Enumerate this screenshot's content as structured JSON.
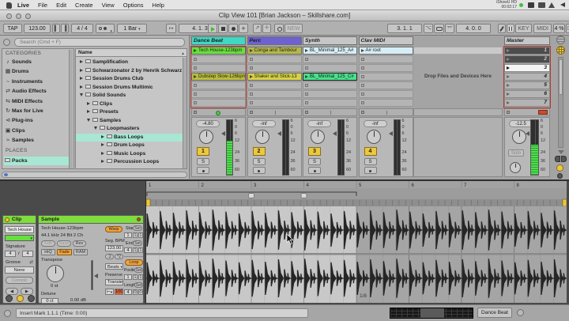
{
  "colors": {
    "accent_orange": "#f2a43c",
    "button_yellow": "#ecc83e",
    "play_green": "#4fd32e",
    "meter_green": "#4ce04c",
    "record_red": "#c2402f",
    "track_teal": "#3fd8c2",
    "track_purple": "#6e62d1",
    "selection_teal": "#a7e7d3",
    "red_border": "#b23a2e",
    "clipview_bg": "#4a4a4a"
  },
  "menu_bar": {
    "items": [
      "Live",
      "File",
      "Edit",
      "Create",
      "View",
      "Options",
      "Help"
    ],
    "status_line1": "iShowU HD",
    "status_line2": "00:02:17"
  },
  "title_bar": {
    "title": "Clip View 101  [Brian Jackson – Skillshare.com]"
  },
  "transport": {
    "tap": "TAP",
    "tempo": "123.00",
    "signature": "4 / 4",
    "quantization": "1 Bar",
    "arrangement_position": "4. 1. 3",
    "loop_start": "3. 1. 1",
    "loop_length": "4. 0. 0",
    "new_label": "NEW",
    "key_label": "KEY",
    "midi_label": "MIDI",
    "cpu": "4 %",
    "disk": "D"
  },
  "browser": {
    "search_placeholder": "Search (Cmd + F)",
    "categories_header": "CATEGORIES",
    "categories": [
      {
        "label": "Sounds",
        "icon": "note-icon"
      },
      {
        "label": "Drums",
        "icon": "drum-grid-icon"
      },
      {
        "label": "Instruments",
        "icon": "wave-icon"
      },
      {
        "label": "Audio Effects",
        "icon": "audio-fx-icon"
      },
      {
        "label": "MIDI Effects",
        "icon": "midi-fx-icon"
      },
      {
        "label": "Max for Live",
        "icon": "max-icon"
      },
      {
        "label": "Plug-ins",
        "icon": "plug-icon"
      },
      {
        "label": "Clips",
        "icon": "clip-icon"
      },
      {
        "label": "Samples",
        "icon": "sample-icon"
      }
    ],
    "places_header": "PLACES",
    "places": [
      {
        "label": "Packs",
        "selected": true
      }
    ],
    "name_header": "Name",
    "tree": [
      {
        "label": "Samplification",
        "depth": 0,
        "disclosure": "right"
      },
      {
        "label": "Schwarzonator 2 by Henrik Schwarz",
        "depth": 0,
        "disclosure": "right"
      },
      {
        "label": "Session Drums Club",
        "depth": 0,
        "disclosure": "right"
      },
      {
        "label": "Session Drums Multimic",
        "depth": 0,
        "disclosure": "right"
      },
      {
        "label": "Solid Sounds",
        "depth": 0,
        "disclosure": "down"
      },
      {
        "label": "Clips",
        "depth": 1,
        "disclosure": "right"
      },
      {
        "label": "Presets",
        "depth": 1,
        "disclosure": "right"
      },
      {
        "label": "Samples",
        "depth": 1,
        "disclosure": "down"
      },
      {
        "label": "Loopmasters",
        "depth": 2,
        "disclosure": "down"
      },
      {
        "label": "Bass Loops",
        "depth": 3,
        "disclosure": "right",
        "selected": true
      },
      {
        "label": "Drum Loops",
        "depth": 3,
        "disclosure": "right"
      },
      {
        "label": "Music Loops",
        "depth": 3,
        "disclosure": "right"
      },
      {
        "label": "Percussion Loops",
        "depth": 3,
        "disclosure": "right"
      }
    ]
  },
  "session": {
    "drop_hint": "Drop Files and Devices Here",
    "rows": 7,
    "tracks": [
      {
        "name": "Dance Beat",
        "color": "#3fd8c2",
        "armed": true,
        "clips": [
          {
            "row": 0,
            "name": "Tech House-123bpm",
            "color": "#66e03c",
            "playing": true
          },
          {
            "row": 3,
            "name": "Dubstep Slow-126bpm",
            "color": "#b9bd3c"
          }
        ]
      },
      {
        "name": "Perc",
        "color": "#6e62d1",
        "clips": [
          {
            "row": 0,
            "name": "Conga and Tambour",
            "color": "#b4b84a"
          },
          {
            "row": 3,
            "name": "Shaker and Stick-13",
            "color": "#d6d145"
          }
        ]
      },
      {
        "name": "Synth",
        "color": "#c6c6c6",
        "clips": [
          {
            "row": 0,
            "name": "BL_Minimal_125_A#",
            "color": "#d6edf5"
          },
          {
            "row": 3,
            "name": "BL_Minimal_125_C#",
            "color": "#49e18c",
            "selected": true
          }
        ]
      },
      {
        "name": "Clav MIDI",
        "color": "#c6c6c6",
        "clips": [
          {
            "row": 0,
            "name": "A# root",
            "color": "#d6edf5"
          }
        ]
      }
    ],
    "master": {
      "label": "Master",
      "scenes": [
        {
          "label": "1",
          "state": "dark"
        },
        {
          "label": "2",
          "state": "dark"
        },
        {
          "label": "3",
          "state": "selected"
        },
        {
          "label": "4",
          "state": "normal"
        },
        {
          "label": "5",
          "state": "normal"
        },
        {
          "label": "6",
          "state": "normal"
        },
        {
          "label": "7",
          "state": "normal"
        }
      ]
    }
  },
  "mixer": {
    "meter_scale": [
      "6",
      "0",
      "6",
      "12",
      "24",
      "36",
      "60"
    ],
    "solo_label": "S",
    "tracks": [
      {
        "number": "1",
        "gain": "-4.80",
        "level": 0.62
      },
      {
        "number": "2",
        "gain": "-inf",
        "level": 0
      },
      {
        "number": "3",
        "gain": "-inf",
        "level": 0
      },
      {
        "number": "4",
        "gain": "-inf",
        "level": 0
      }
    ],
    "master": {
      "gain": "-12.5",
      "solo_label": "Solo",
      "level": 0.55
    }
  },
  "clip_panel": {
    "clip_box": {
      "title": "Clip",
      "name": "Tech House",
      "signature_label": "Signature",
      "sig_num": "4",
      "sig_den": "4",
      "groove_label": "Groove",
      "groove": "None",
      "commit": "Commit"
    },
    "sample_box": {
      "title": "Sample",
      "sample_name": "Tech House-123bpm",
      "format": "44.1 kHz 24 Bit 2 Ch",
      "edit": "Edit",
      "save": "Save",
      "rev": "Rev",
      "hiq": "HiQ",
      "fade": "Fade",
      "ram": "RAM",
      "transpose_label": "Transpose",
      "transpose": "0 st",
      "detune_label": "Detune",
      "detune": "0 ct",
      "gain": "0.00 dB",
      "warp": "Warp",
      "seg_bpm_label": "Seg. BPM",
      "seg_bpm": "123.00",
      "half": ":2",
      "double": "*2",
      "warp_mode": "Beats",
      "preserve_label": "Preserve",
      "transients": "Transie",
      "transient_res": "100",
      "start_label": "Start",
      "end_label": "End",
      "set_label": "Set",
      "start": [
        "1",
        "1",
        "1"
      ],
      "end": [
        "4",
        "1",
        "1"
      ],
      "loop_label": "Loop",
      "position_label": "Position",
      "length_label": "Length",
      "position": [
        "1",
        "1",
        "1"
      ],
      "length": [
        "4",
        "0",
        "0"
      ]
    }
  },
  "waveform": {
    "bar_numbers": [
      "1",
      "2",
      "3",
      "4",
      "5",
      "6",
      "7",
      "8"
    ],
    "loop_bars": 4,
    "total_bars": 8,
    "grid_label": "1/8"
  },
  "status_bar": {
    "info": "Insert Mark 1.1.1 (Time: 0:00)",
    "selected_track": "Dance Beat"
  }
}
